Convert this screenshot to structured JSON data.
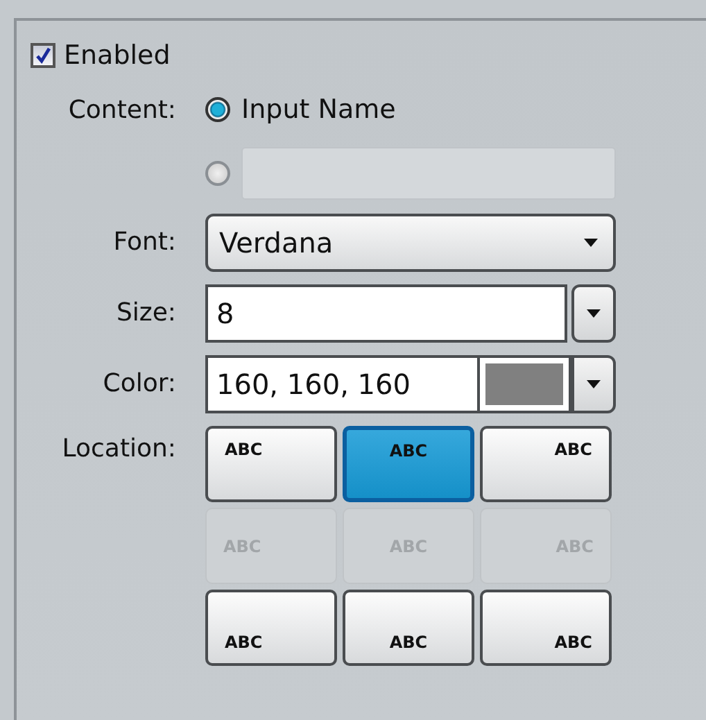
{
  "enabled": {
    "label": "Enabled",
    "checked": true
  },
  "content": {
    "label": "Content:",
    "options": [
      {
        "kind": "text",
        "label": "Input Name",
        "selected": true
      },
      {
        "kind": "field",
        "selected": false,
        "disabled": true
      }
    ]
  },
  "font": {
    "label": "Font:",
    "value": "Verdana"
  },
  "size": {
    "label": "Size:",
    "value": "8"
  },
  "color": {
    "label": "Color:",
    "value": "160, 160, 160",
    "color": "#808080"
  },
  "location": {
    "label": "Location:",
    "cells": [
      {
        "label": "ABC",
        "selected": false,
        "disabled": false
      },
      {
        "label": "ABC",
        "selected": true,
        "disabled": false
      },
      {
        "label": "ABC",
        "selected": false,
        "disabled": false
      },
      {
        "label": "ABC",
        "selected": false,
        "disabled": true
      },
      {
        "label": "ABC",
        "selected": false,
        "disabled": true
      },
      {
        "label": "ABC",
        "selected": false,
        "disabled": true
      },
      {
        "label": "ABC",
        "selected": false,
        "disabled": false
      },
      {
        "label": "ABC",
        "selected": false,
        "disabled": false
      },
      {
        "label": "ABC",
        "selected": false,
        "disabled": false
      }
    ]
  }
}
